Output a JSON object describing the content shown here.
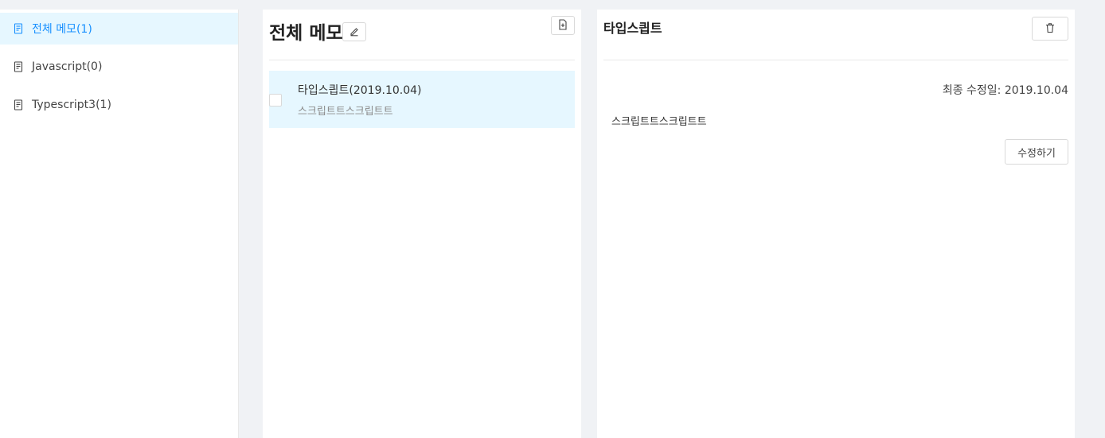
{
  "sidebar": {
    "items": [
      {
        "label": "전체 메모(1)",
        "icon": "memo-icon",
        "active": true
      },
      {
        "label": "Javascript(0)",
        "icon": "memo-icon",
        "active": false
      },
      {
        "label": "Typescript3(1)",
        "icon": "memo-icon",
        "active": false
      }
    ]
  },
  "list": {
    "title": "전체 메모",
    "edit_icon": "pencil-icon",
    "new_icon": "new-file-icon",
    "memos": [
      {
        "title": "타입스킙트(2019.10.04)",
        "preview": "스크립트트스크립트트",
        "selected": true
      }
    ]
  },
  "detail": {
    "title": "타입스킙트",
    "delete_icon": "trash-icon",
    "modified": "최종 수정일: 2019.10.04",
    "body": "스크립트트스크립트트",
    "edit_label": "수정하기"
  },
  "colors": {
    "accent": "#1890ff",
    "selected_bg": "#e6f7ff",
    "page_bg": "#f0f2f5"
  }
}
